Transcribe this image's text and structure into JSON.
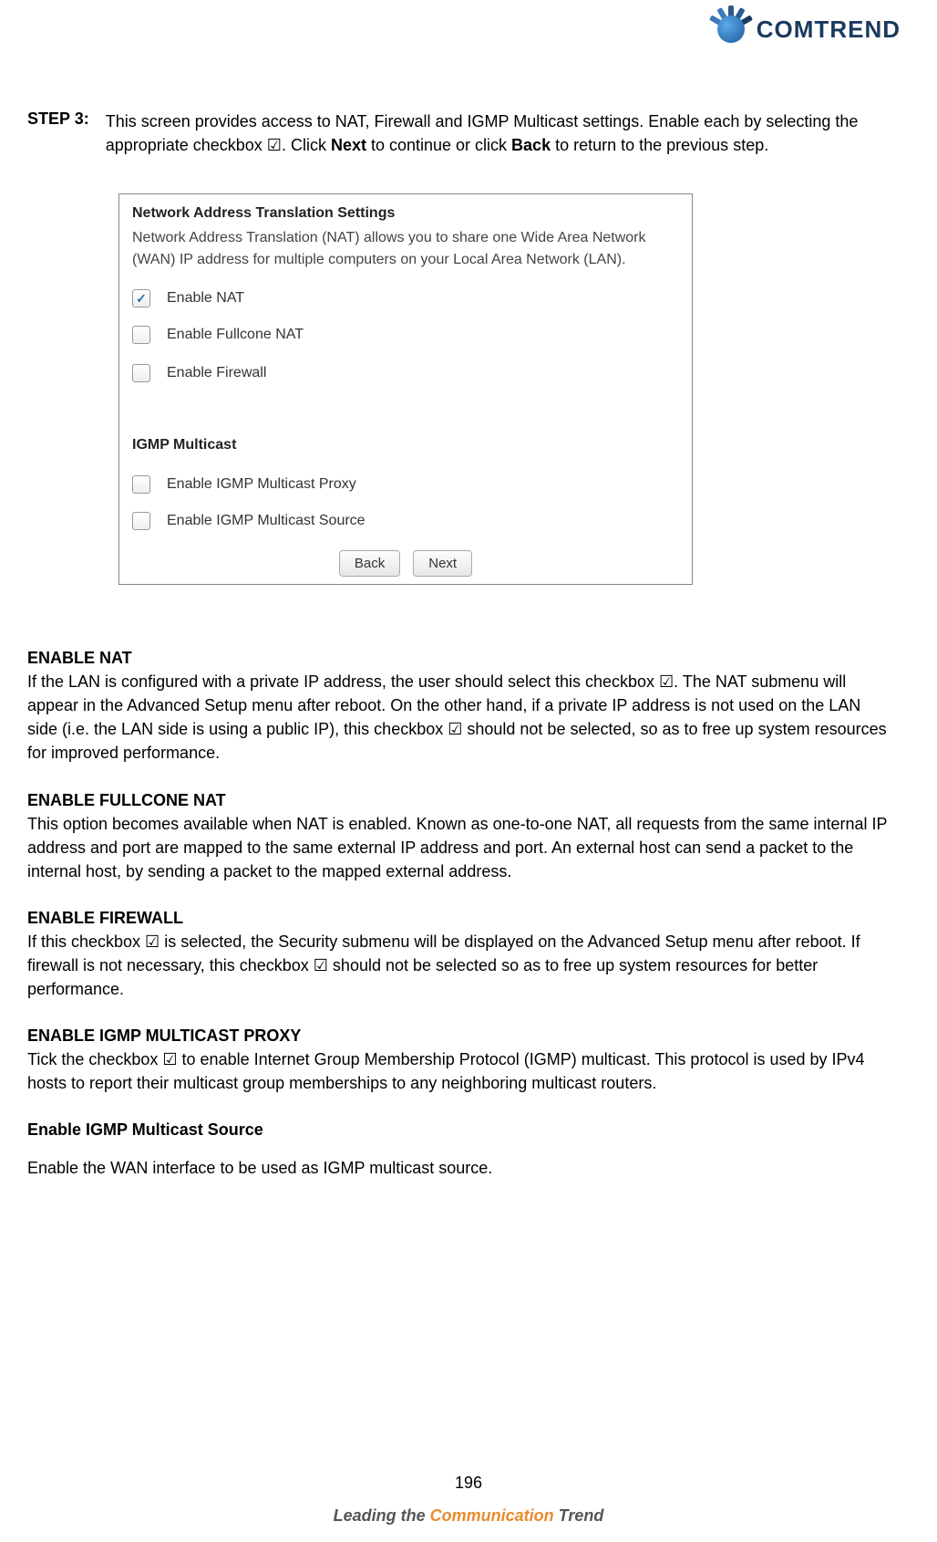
{
  "logo": {
    "brand": "COMTREND"
  },
  "step": {
    "label": "STEP 3:",
    "text_1": "This screen provides access to NAT, Firewall and IGMP Multicast settings. Enable each by selecting the appropriate checkbox ☑. Click ",
    "b1": "Next",
    "text_2": " to continue or click ",
    "b2": "Back",
    "text_3": " to return to the previous step."
  },
  "panel": {
    "nat_title": "Network Address Translation Settings",
    "nat_desc": "Network Address Translation (NAT) allows you to share one Wide Area Network (WAN) IP address for multiple computers on your Local Area Network (LAN).",
    "cb_enable_nat": "Enable NAT",
    "cb_fullcone": "Enable Fullcone NAT",
    "cb_firewall": "Enable Firewall",
    "igmp_title": "IGMP Multicast",
    "cb_igmp_proxy": "Enable IGMP Multicast Proxy",
    "cb_igmp_source": "Enable IGMP Multicast Source",
    "btn_back": "Back",
    "btn_next": "Next"
  },
  "sections": {
    "s1_h": "ENABLE NAT",
    "s1_t": "If the LAN is configured with a private IP address, the user should select this checkbox ☑.   The NAT submenu will appear in the Advanced Setup menu after reboot.   On the other hand, if a private IP address is not used on the LAN side (i.e. the LAN side is using a public IP), this checkbox ☑ should not be selected, so as to free up system resources for improved performance.",
    "s2_h": "ENABLE FULLCONE NAT",
    "s2_t": "This option becomes available when NAT is enabled. Known as one-to-one NAT, all requests from the same internal IP address and port are mapped to the same external IP address and port. An external host can send a packet to the internal host, by sending a packet to the mapped external address.",
    "s3_h": "ENABLE FIREWALL",
    "s3_t": "If this checkbox ☑ is selected, the Security submenu will be displayed on the Advanced Setup menu after reboot.   If firewall is not necessary, this checkbox ☑ should not be selected so as to free up system resources for better performance.",
    "s4_h": "ENABLE IGMP MULTICAST PROXY",
    "s4_t": "Tick the checkbox ☑ to enable Internet Group Membership Protocol (IGMP) multicast. This protocol is used by IPv4 hosts to report their multicast group memberships to any neighboring multicast routers.",
    "s5_h": "Enable IGMP Multicast Source",
    "s5_t": "Enable the WAN interface to be used as IGMP multicast source."
  },
  "page_number": "196",
  "footer": {
    "t1": "Leading the ",
    "t2": "Communication",
    "t3": " Trend"
  }
}
